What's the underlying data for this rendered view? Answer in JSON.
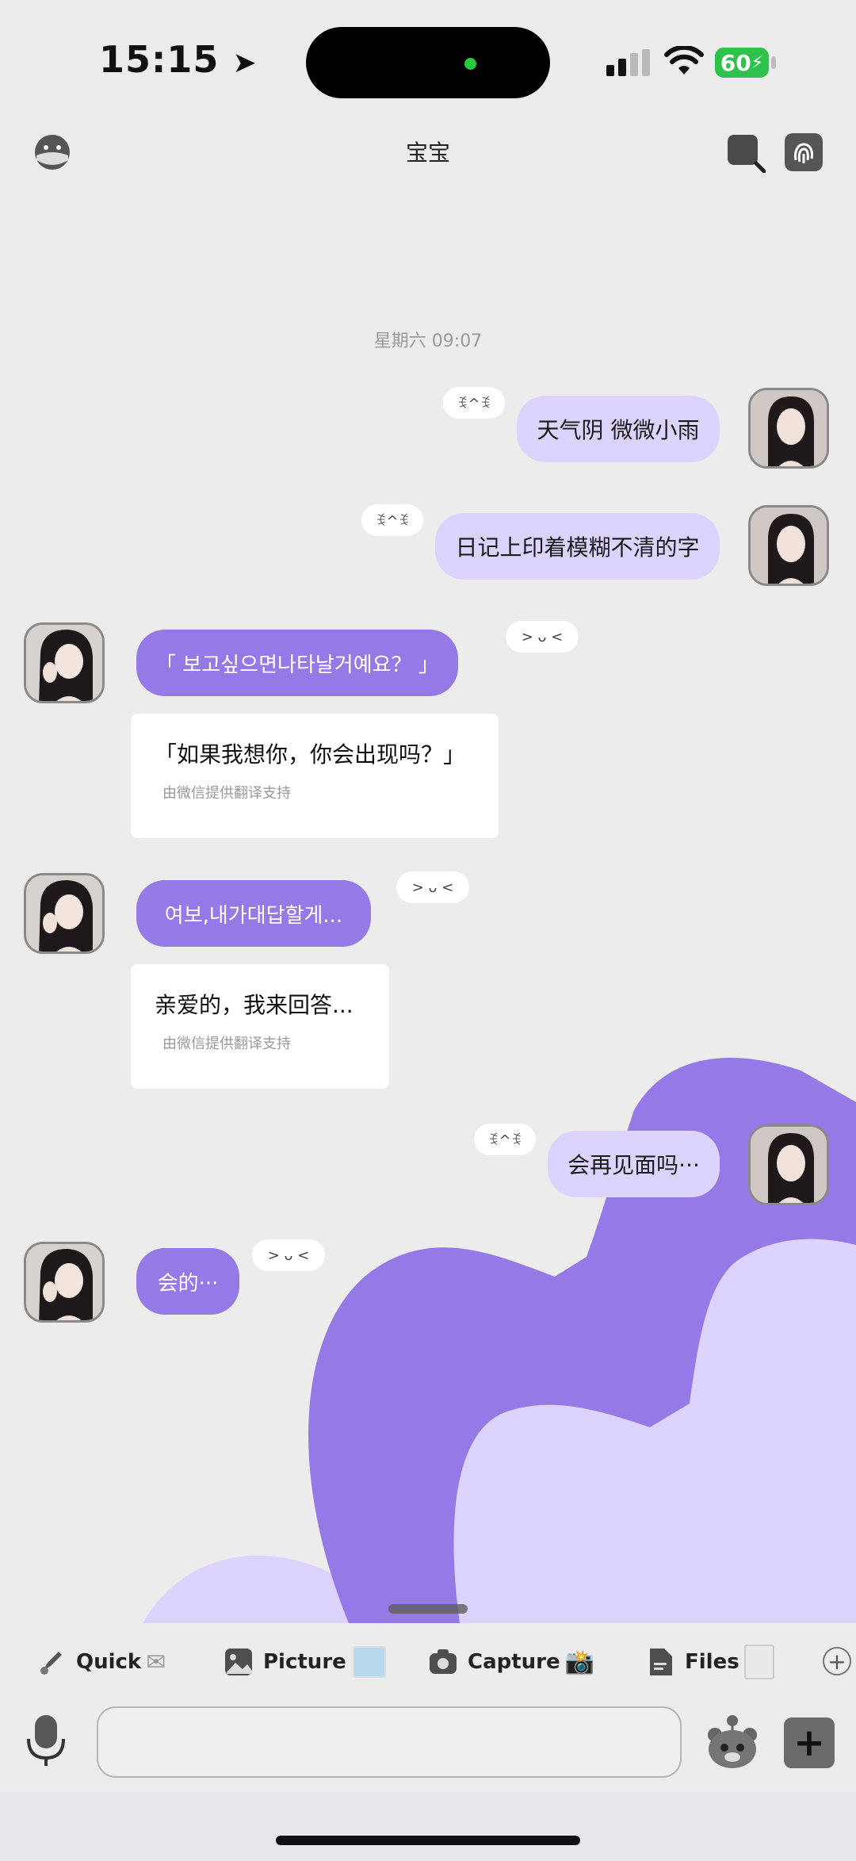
{
  "status_bar": {
    "time": "15:15",
    "battery": "60"
  },
  "header": {
    "title": "宝宝"
  },
  "chat": {
    "timestamp": "星期六 09:07",
    "messages": [
      {
        "side": "me",
        "text": "天气阴  微微小雨",
        "emote": "ꉂ^ꉂ"
      },
      {
        "side": "me",
        "text": "日记上印着模糊不清的字",
        "emote": "ꉂ^ꉂ"
      },
      {
        "side": "them",
        "text": "「  보고싶으면나타날거예요？ 」",
        "emote": "> ᴗ <",
        "translation": "「如果我想你，你会出现吗？」",
        "translation_note": "由微信提供翻译支持"
      },
      {
        "side": "them",
        "text": "여보,내가대답할게...",
        "emote": "> ᴗ <",
        "translation": "亲爱的，我来回答...",
        "translation_note": "由微信提供翻译支持"
      },
      {
        "side": "me",
        "text": "会再见面吗···",
        "emote": "ꉂ^ꉂ"
      },
      {
        "side": "them",
        "text": "会的···",
        "emote": "> ᴗ <"
      }
    ]
  },
  "quick_bar": {
    "items": [
      {
        "label": "Quick",
        "icon": "rocket-icon"
      },
      {
        "label": "Picture",
        "icon": "picture-icon"
      },
      {
        "label": "Capture",
        "icon": "camera-icon"
      },
      {
        "label": "Files",
        "icon": "file-icon"
      }
    ]
  },
  "colors": {
    "accent_purple": "#9579e6",
    "light_purple": "#dcd3ff",
    "background": "#ececec"
  }
}
